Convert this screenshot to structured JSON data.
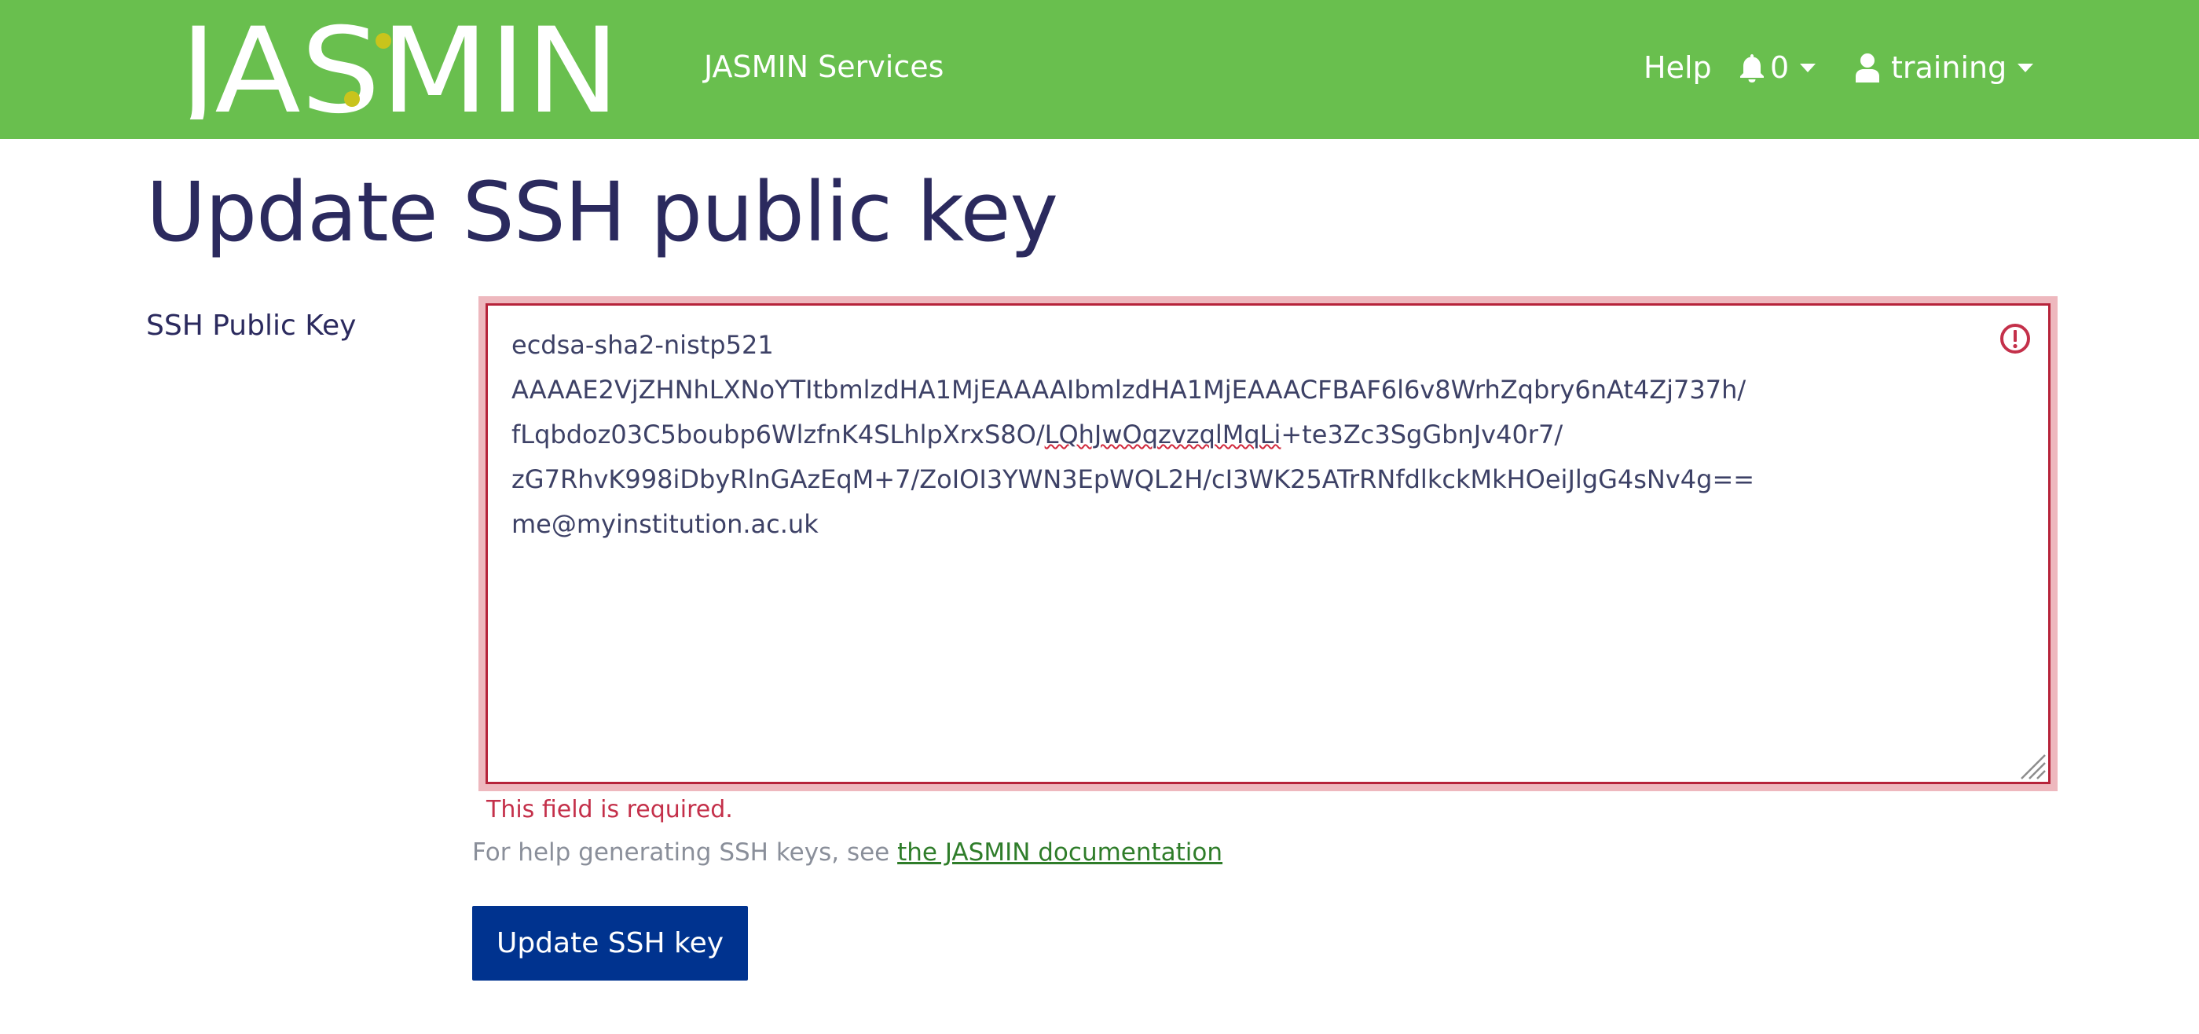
{
  "header": {
    "logo_text": "JASMIN",
    "services_label": "JASMIN Services",
    "help_label": "Help",
    "notifications_count": "0",
    "user_name": "training",
    "nav_bg": "#69bf4e",
    "logo_dot_color": "#c9c41c"
  },
  "page": {
    "title": "Update SSH public key"
  },
  "form": {
    "ssh_key_label": "SSH Public Key",
    "ssh_key_lines": [
      "ecdsa-sha2-nistp521",
      "AAAAE2VjZHNhLXNoYTItbmlzdHA1MjEAAAAIbmlzdHA1MjEAAACFBAF6l6v8WrhZqbry6nAt4Zj737h/",
      {
        "before": "fLqbdoz03C5boubp6WlzfnK4SLhlpXrxS8O/",
        "misspelled": "LQhJwOqzvzqlMqLi",
        "after": "+te3Zc3SgGbnJv40r7/"
      },
      "zG7RhvK998iDbyRlnGAzEqM+7/ZoIOI3YWN3EpWQL2H/cI3WK25ATrRNfdlkckMkHOeiJlgG4sNv4g==",
      "me@myinstitution.ac.uk"
    ],
    "error_message": "This field is required.",
    "help_prefix": "For help generating SSH keys, see ",
    "help_link_text": "the JASMIN documentation",
    "submit_label": "Update SSH key",
    "error_color": "#b6233a",
    "button_color": "#00338f"
  }
}
